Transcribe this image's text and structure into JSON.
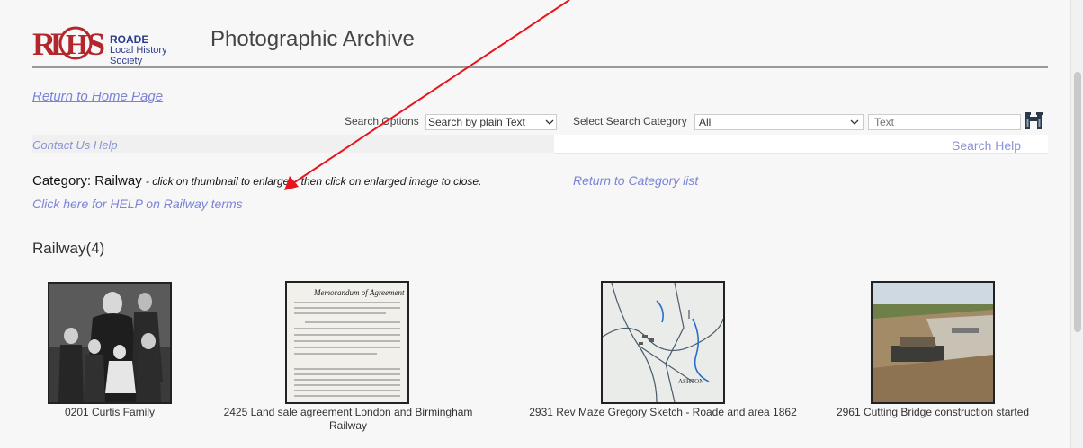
{
  "header": {
    "logo": {
      "mark": "RLHS",
      "line1": "ROADE",
      "line2": "Local History Society"
    },
    "title": "Photographic Archive"
  },
  "nav": {
    "home_link": "Return to Home Page"
  },
  "search": {
    "options_label": "Search Options",
    "options_value": "Search by plain Text",
    "category_label": "Select Search Category",
    "category_value": "All",
    "text_placeholder": "Text",
    "search_icon": "binoculars-icon"
  },
  "help_bar": {
    "contact": "Contact Us Help",
    "search_help": "Search Help"
  },
  "category": {
    "label": "Category:",
    "name": "Railway",
    "note": "- click on thumbnail to enlarge... then click on enlarged image to close.",
    "return_link": "Return to Category list",
    "help_link": "Click here for HELP on Railway terms"
  },
  "section": {
    "heading": "Railway(4)"
  },
  "items": [
    {
      "caption": "0201 Curtis Family"
    },
    {
      "caption": "2425 Land sale agreement London and Birmingham Railway"
    },
    {
      "caption": "2931 Rev Maze Gregory Sketch - Roade and area 1862"
    },
    {
      "caption": "2961 Cutting Bridge construction started"
    }
  ],
  "annotation": {
    "arrow_color": "#e8141c"
  },
  "colors": {
    "link": "#7b83d6",
    "logo_red": "#b3262c",
    "logo_blue": "#2a3a8c"
  }
}
